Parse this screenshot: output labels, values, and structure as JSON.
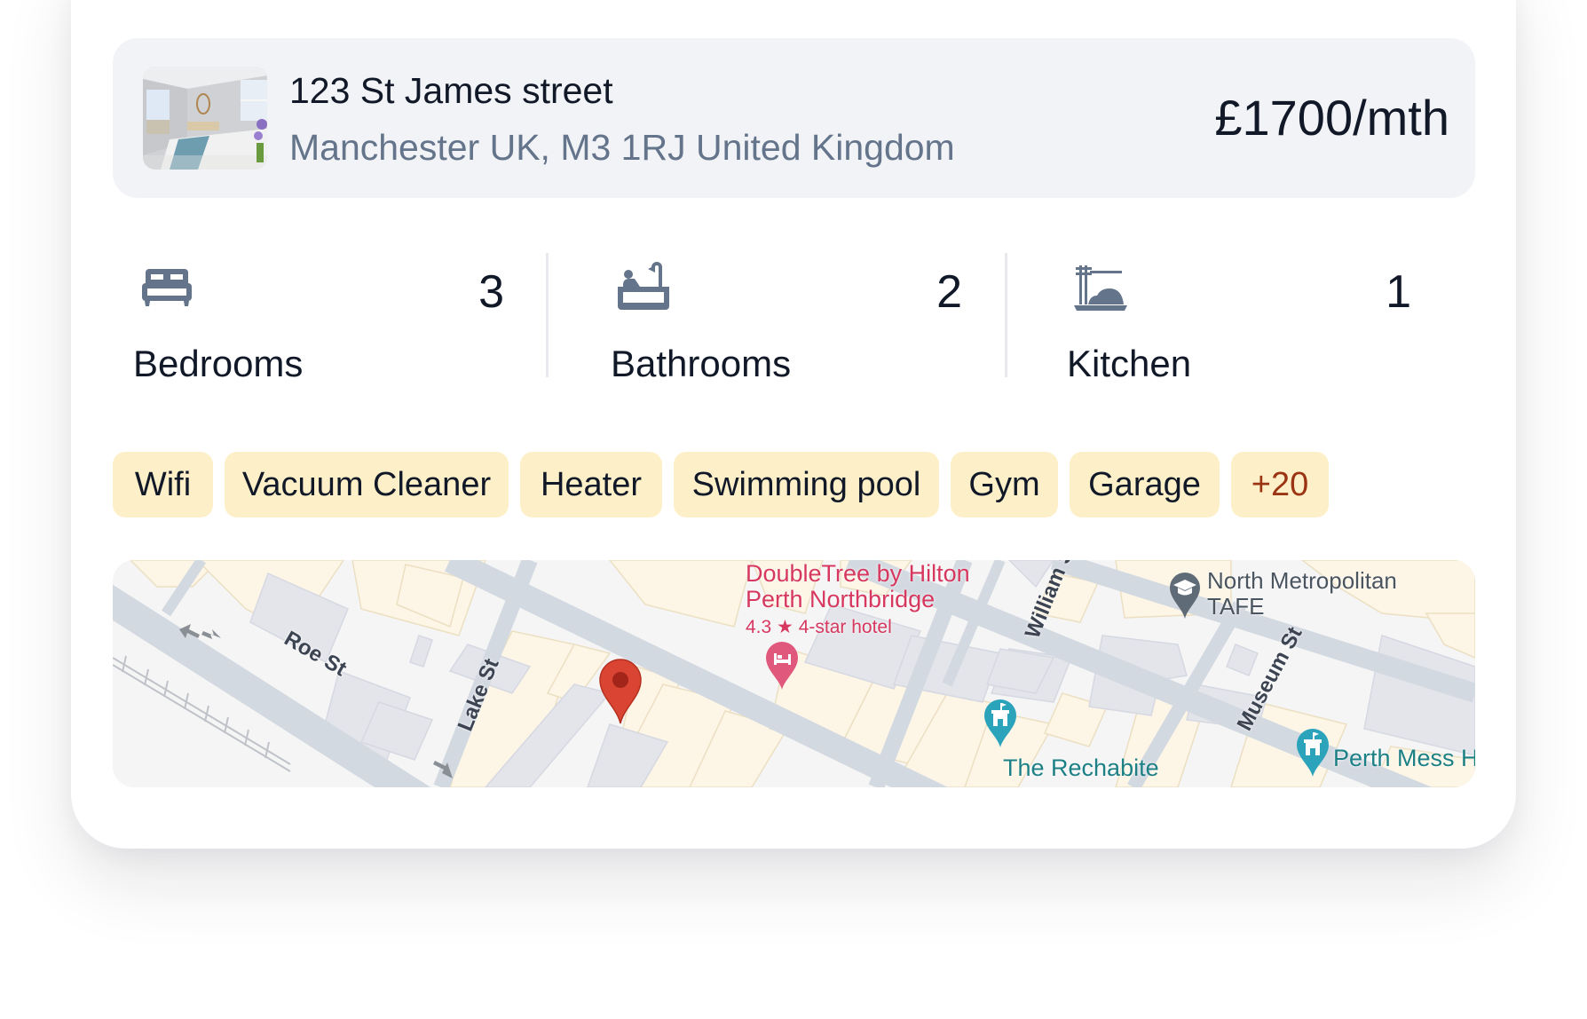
{
  "listing": {
    "title": "123 St James street",
    "address": "Manchester UK, M3 1RJ United Kingdom",
    "price": "£1700/mth",
    "thumbnail": "bedroom-photo"
  },
  "stats": [
    {
      "icon": "bed-icon",
      "label": "Bedrooms",
      "value": "3"
    },
    {
      "icon": "bathtub-icon",
      "label": "Bathrooms",
      "value": "2"
    },
    {
      "icon": "kitchen-icon",
      "label": "Kitchen",
      "value": "1"
    }
  ],
  "amenities": [
    "Wifi",
    "Vacuum Cleaner",
    "Heater",
    "Swimming pool",
    "Gym",
    "Garage"
  ],
  "amenities_more": "+20",
  "map": {
    "streets": [
      "Roe St",
      "Lake St",
      "William St",
      "Museum St"
    ],
    "pois": [
      {
        "name_line1": "DoubleTree by Hilton",
        "name_line2": "Perth Northbridge",
        "rating": "4.3",
        "rating_suffix": "4-star hotel",
        "type": "hotel"
      },
      {
        "name": "The Rechabite",
        "type": "landmark"
      },
      {
        "name_line1": "North Metropolitan",
        "name_line2": "TAFE",
        "type": "school"
      },
      {
        "name": "Perth Mess Ha",
        "type": "landmark"
      }
    ],
    "marker": "location-pin"
  },
  "colors": {
    "header_bg": "#f1f3f7",
    "chip_bg": "#fdf0c9",
    "chip_more_text": "#9a3412",
    "muted_text": "#64748b",
    "primary_text": "#111827",
    "marker_red": "#d94532",
    "hotel_pink": "#e0587c",
    "landmark_teal": "#2ba3bb"
  }
}
